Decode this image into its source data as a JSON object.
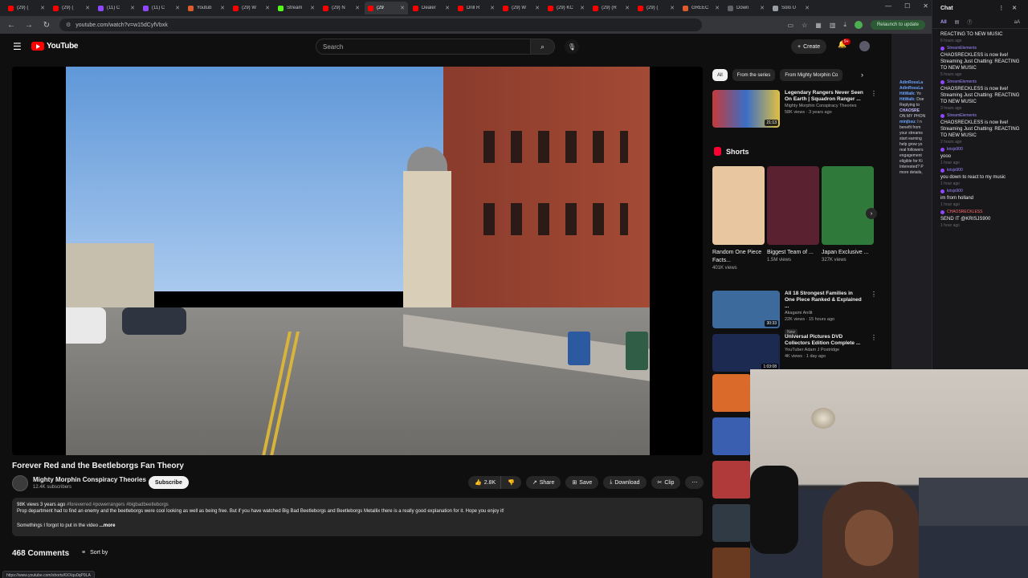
{
  "browser": {
    "tabs": [
      {
        "title": "(29) (",
        "color": "#ff0000"
      },
      {
        "title": "(29) (",
        "color": "#ff0000"
      },
      {
        "title": "(11) C",
        "color": "#9146ff"
      },
      {
        "title": "(11) C",
        "color": "#9146ff"
      },
      {
        "title": "Youtub",
        "color": "#e05a2b"
      },
      {
        "title": "(29) W",
        "color": "#ff0000"
      },
      {
        "title": "Stream",
        "color": "#53fc18"
      },
      {
        "title": "(29) N",
        "color": "#ff0000"
      },
      {
        "title": "(29",
        "color": "#ff0000",
        "active": true
      },
      {
        "title": "Dealer",
        "color": "#ff0000"
      },
      {
        "title": "Drill R",
        "color": "#ff0000"
      },
      {
        "title": "(29) W",
        "color": "#ff0000"
      },
      {
        "title": "(29) KC",
        "color": "#ff0000"
      },
      {
        "title": "(29) (R",
        "color": "#ff0000"
      },
      {
        "title": "(29) (",
        "color": "#ff0000"
      },
      {
        "title": "GREEC",
        "color": "#e05a2b"
      },
      {
        "title": "Down",
        "color": "#5f6368"
      },
      {
        "title": "Solo U",
        "color": "#9aa0a6"
      }
    ],
    "url": "youtube.com/watch?v=w15dCyfVbxk",
    "relaunch_label": "Relaunch to update"
  },
  "youtube": {
    "logo_text": "YouTube",
    "search_placeholder": "Search",
    "create_label": "Create",
    "notification_count": "9+",
    "video": {
      "title": "Forever Red and the Beetleborgs Fan Theory",
      "channel": "Mighty Morphin Conspiracy Theories",
      "subscribers": "12.4K subscribers",
      "subscribe_label": "Subscribe",
      "likes": "2.8K",
      "share_label": "Share",
      "save_label": "Save",
      "download_label": "Download",
      "clip_label": "Clip",
      "views_age": "98K views  3 years ago",
      "hashtags": "#foreverred #powerrangers #bigbadbeetleborgs",
      "description": "Prop department had to find an enemy and the beetleborgs were cool looking as well as being free. But if you have watched Big Bad Beetleborgs and Beetleborgs Metallix there is a really good explanation for it. Hope you enjoy it!",
      "description_2": "Somethings I forgot to put in the video",
      "more_label": "...more"
    },
    "comments_count": "468 Comments",
    "sort_label": "Sort by",
    "status_url": "https://www.youtube.com/shorts/6XXqu0qP9LA",
    "chips": [
      {
        "label": "All",
        "active": true
      },
      {
        "label": "From the series"
      },
      {
        "label": "From Mighty Morphin Co"
      }
    ],
    "rec_top": {
      "title": "Legendary Rangers Never Seen On Earth | Squadron Ranger ...",
      "channel": "Mighty Morphin Conspiracy Theories",
      "meta": "58K views · 3 years ago",
      "duration": "21:13"
    },
    "shorts_label": "Shorts",
    "shorts": [
      {
        "title": "Random One Piece Facts...",
        "views": "401K views",
        "color": "#e8c7a0"
      },
      {
        "title": "Biggest Team of ...",
        "views": "1.5M views",
        "color": "#5a2230"
      },
      {
        "title": "Japan Exclusive ...",
        "views": "327K views",
        "color": "#2f7a3a"
      }
    ],
    "rec_list": [
      {
        "title": "All 18 Strongest Families in One Piece Ranked & Explained ...",
        "channel": "Akagami Anilit",
        "meta": "22K views · 15 hours ago",
        "badge": "New",
        "duration": "30:33",
        "color": "#3c6a9c"
      },
      {
        "title": "Universal Pictures DVD Collectors Edition Complete ...",
        "channel": "YouTuber Adam J Postridge",
        "meta": "4K views · 1 day ago",
        "badge": "",
        "duration": "1:03:08",
        "color": "#1c2a52"
      }
    ],
    "side_thumbs": [
      "#d96a2a",
      "#3a5fb0",
      "#b03a3a",
      "#2f3a44",
      "#6a3a20"
    ]
  },
  "chat": {
    "title": "Chat",
    "tab_all": "All",
    "messages": [
      {
        "user": "",
        "text": "REACTING TO NEW MUSIC",
        "time": "6 hours ago"
      },
      {
        "user": "StreamElements",
        "text": "CHAOSRECKLESS is now live! Streaming Just Chatting: REACTING TO NEW MUSIC",
        "time": "5 hours ago"
      },
      {
        "user": "StreamElements",
        "text": "CHAOSRECKLESS is now live! Streaming Just Chatting: REACTING TO NEW MUSIC",
        "time": "3 hours ago"
      },
      {
        "user": "StreamElements",
        "text": "CHAOSRECKLESS is now live! Streaming Just Chatting: REACTING TO NEW MUSIC",
        "time": "2 hours ago"
      },
      {
        "user": "krisjs900",
        "text": "yooo",
        "time": "1 hour ago"
      },
      {
        "user": "krisjs900",
        "text": "you down to react to my music",
        "time": "1 hour ago"
      },
      {
        "user": "krisjs900",
        "text": "im from holland",
        "time": "1 hour ago"
      },
      {
        "user": "CHAOSRECKLESS",
        "text": "SEND IT @KRISJS900",
        "time": "1 hour ago",
        "red": true
      }
    ],
    "obs_lines": [
      {
        "user": "AdinRossLa",
        "text": "",
        "cls": "u"
      },
      {
        "user": "AdinRossLa",
        "text": "",
        "cls": "u"
      },
      {
        "user": "HitWalk:",
        "text": " Yo",
        "cls": "u"
      },
      {
        "user": "HitWalk:",
        "text": " Doe",
        "cls": "u"
      },
      {
        "user": "",
        "text": "",
        "cls": "u"
      },
      {
        "user": "",
        "text": "Replying to",
        "cls": "u"
      },
      {
        "user": "CHAOSRE",
        "text": "",
        "cls": "u2"
      },
      {
        "user": "",
        "text": "ON MY PHON",
        "cls": "u"
      },
      {
        "user": "minjbsu:",
        "text": " I n",
        "cls": "u"
      },
      {
        "user": "",
        "text": "benefit from",
        "cls": "u"
      },
      {
        "user": "",
        "text": "your streams",
        "cls": "u"
      },
      {
        "user": "",
        "text": "start earning",
        "cls": "u"
      },
      {
        "user": "",
        "text": "help grow yo",
        "cls": "u"
      },
      {
        "user": "",
        "text": "real followers",
        "cls": "u"
      },
      {
        "user": "",
        "text": "engagement",
        "cls": "u"
      },
      {
        "user": "",
        "text": "eligible for Ki",
        "cls": "u"
      },
      {
        "user": "",
        "text": "Interested? P",
        "cls": "u"
      },
      {
        "user": "",
        "text": "more details,",
        "cls": "u"
      }
    ]
  }
}
